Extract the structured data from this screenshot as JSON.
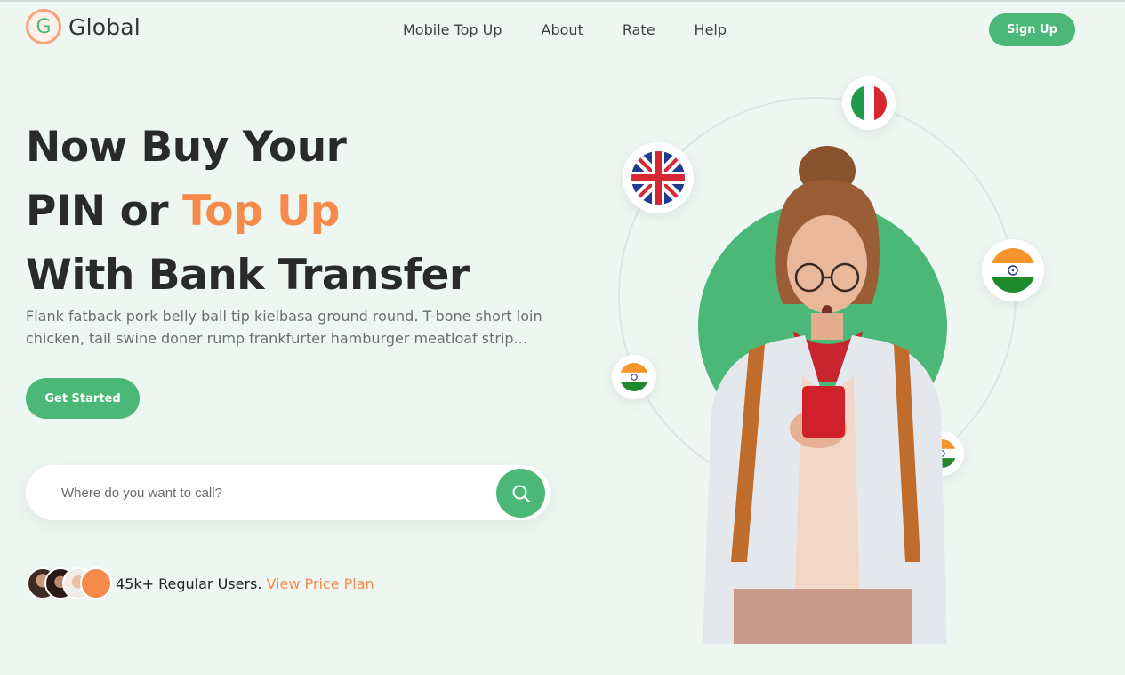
{
  "brand": {
    "logo_letter": "G",
    "name": "Global"
  },
  "nav": {
    "items": [
      {
        "label": "Mobile Top Up"
      },
      {
        "label": "About"
      },
      {
        "label": "Rate"
      },
      {
        "label": "Help"
      }
    ]
  },
  "header": {
    "signup_label": "Sign Up"
  },
  "hero": {
    "line1": "Now Buy Your",
    "line2_prefix": "PIN or ",
    "line2_accent": "Top Up",
    "line3": "With Bank Transfer",
    "description": "Flank fatback pork belly ball tip kielbasa ground round. T-bone short loin chicken, tail swine doner rump frankfurter hamburger meatloaf strip...",
    "cta_label": "Get Started"
  },
  "search": {
    "placeholder": "Where do you want to call?",
    "value": ""
  },
  "users": {
    "count_text": "45k+ Regular Users.",
    "link_text": "View Price Plan"
  },
  "colors": {
    "accent_green": "#4bb877",
    "accent_orange": "#f58a4b",
    "background": "#eef6f2"
  },
  "flags": [
    "italy-flag",
    "uk-flag",
    "india-flag",
    "india-flag",
    "india-flag"
  ]
}
